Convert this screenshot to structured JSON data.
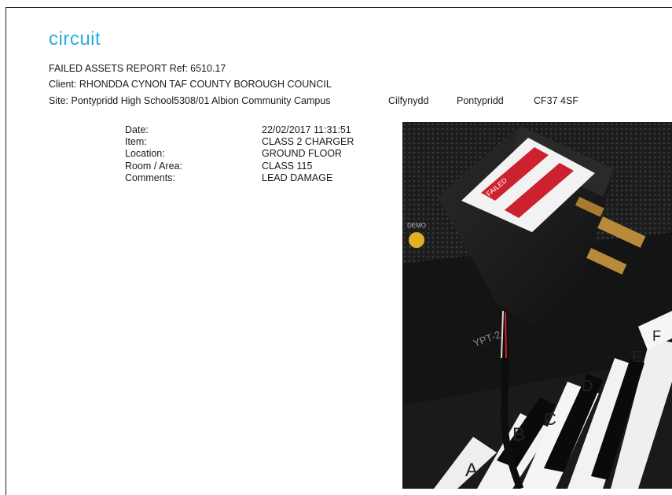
{
  "logo": {
    "text": "circuit",
    "color": "#29abe2"
  },
  "report": {
    "title": "FAILED ASSETS REPORT Ref: 6510.17",
    "client": "Client: RHONDDA CYNON TAF COUNTY BOROUGH COUNCIL",
    "site": {
      "name": "Site: Pontypridd High School5308/01 Albion Community Campus",
      "locality": "Cilfynydd",
      "town": "Pontypridd",
      "postcode": "CF37 4SF"
    }
  },
  "details": {
    "labels": [
      "Date:",
      "Item:",
      "Location:",
      "Room / Area:",
      "Comments:"
    ],
    "values": [
      "22/02/2017 11:31:51",
      "CLASS 2 CHARGER",
      "GROUND FLOOR",
      "CLASS 115",
      "LEAD DAMAGE"
    ]
  },
  "photo": {
    "model_text": "YPT-2",
    "demo_text": "DEMO",
    "key_letters": [
      "A",
      "B",
      "C",
      "D",
      "E",
      "F"
    ],
    "label_text": "FAILED"
  }
}
